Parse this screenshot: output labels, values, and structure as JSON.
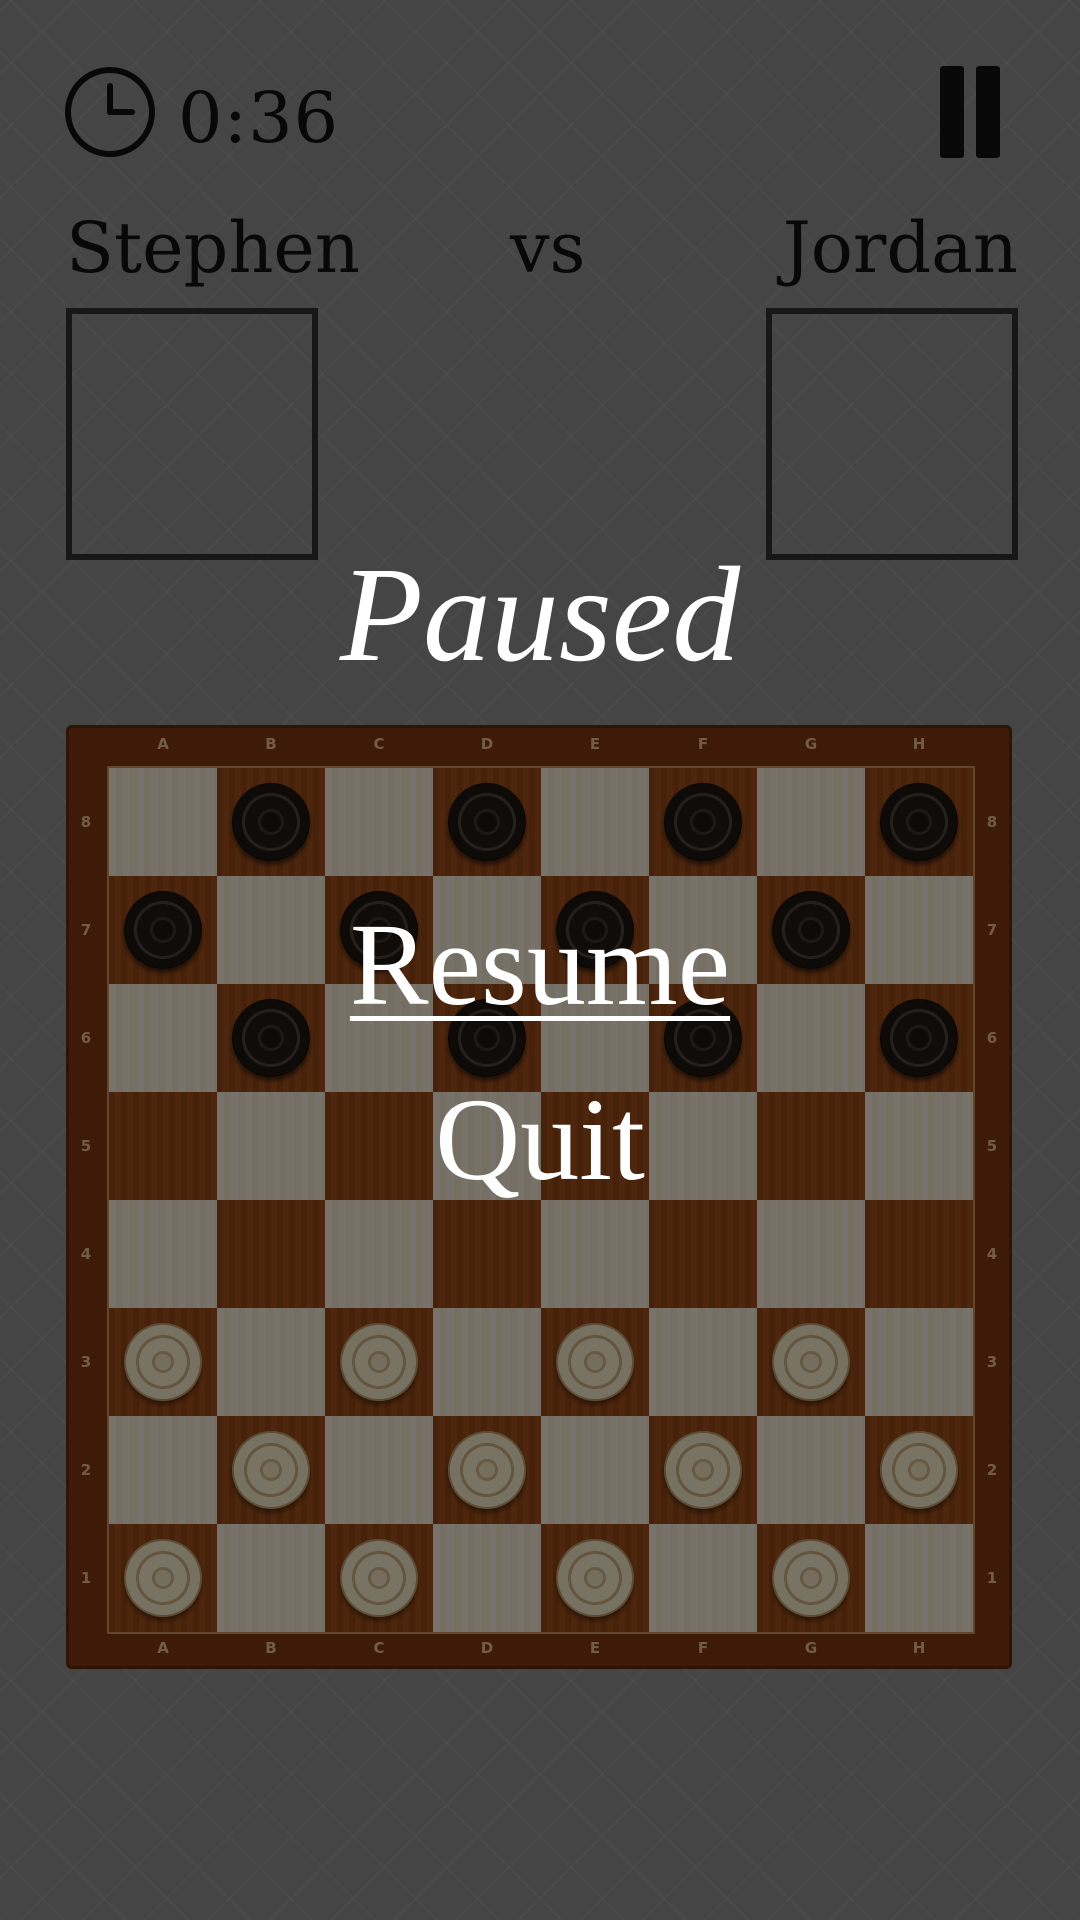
{
  "timer": {
    "elapsed": "0:36"
  },
  "players": {
    "left": "Stephen",
    "vs": "vs",
    "right": "Jordan"
  },
  "pause_menu": {
    "title": "Paused",
    "resume_label": "Resume",
    "quit_label": "Quit"
  },
  "board": {
    "files": [
      "A",
      "B",
      "C",
      "D",
      "E",
      "F",
      "G",
      "H"
    ],
    "ranks": [
      "8",
      "7",
      "6",
      "5",
      "4",
      "3",
      "2",
      "1"
    ],
    "rows": [
      [
        "",
        "b",
        "",
        "b",
        "",
        "b",
        "",
        "b"
      ],
      [
        "b",
        "",
        "b",
        "",
        "b",
        "",
        "b",
        ""
      ],
      [
        "",
        "b",
        "",
        "b",
        "",
        "b",
        "",
        "b"
      ],
      [
        "",
        "",
        "",
        "",
        "",
        "",
        "",
        ""
      ],
      [
        "",
        "",
        "",
        "",
        "",
        "",
        "",
        ""
      ],
      [
        "w",
        "",
        "w",
        "",
        "w",
        "",
        "w",
        ""
      ],
      [
        "",
        "w",
        "",
        "w",
        "",
        "w",
        "",
        "w"
      ],
      [
        "w",
        "",
        "w",
        "",
        "w",
        "",
        "w",
        ""
      ]
    ]
  },
  "colors": {
    "board_frame": "#7a3610",
    "light_square": "#f1e6d4",
    "dark_square": "#8f4416",
    "overlay": "rgba(0,0,0,0.5)",
    "menu_text": "#ffffff"
  },
  "icons": {
    "clock": "clock-icon",
    "pause": "pause-icon"
  }
}
